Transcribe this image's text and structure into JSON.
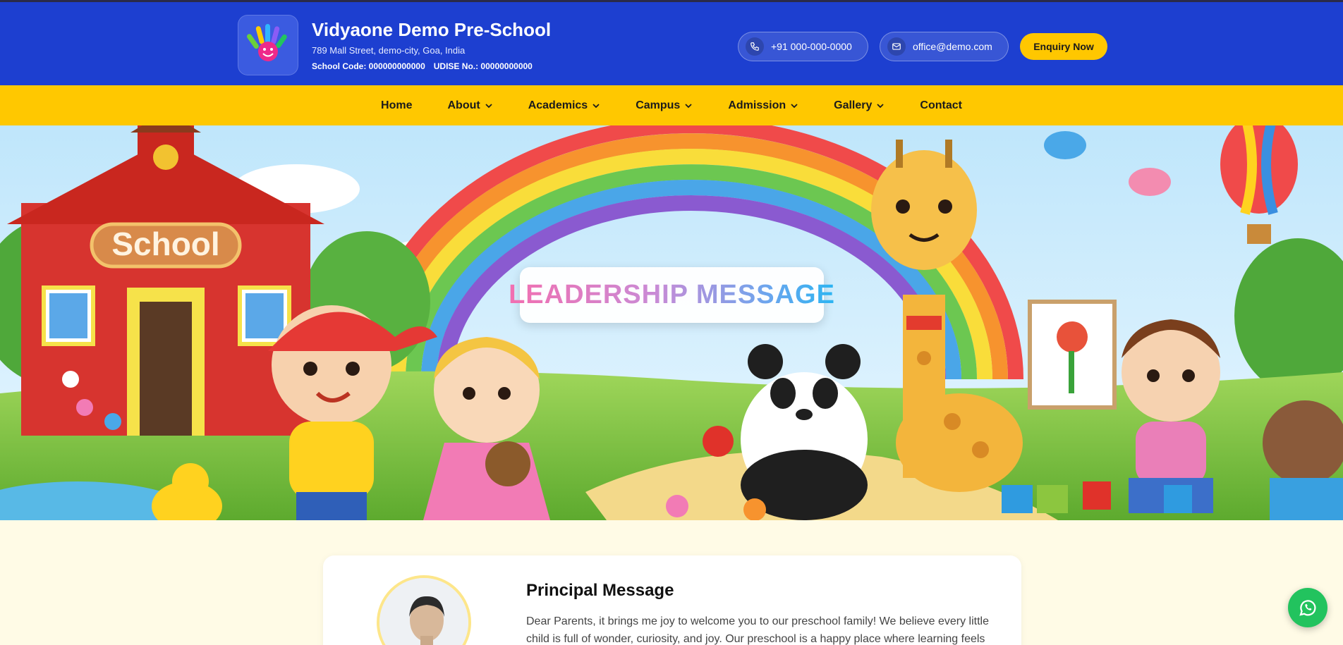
{
  "header": {
    "school_name": "Vidyaone Demo Pre-School",
    "address": "789 Mall Street, demo-city, Goa, India",
    "school_code": "School Code: 000000000000",
    "udise": "UDISE No.: 00000000000",
    "phone": "+91 000-000-0000",
    "email": "office@demo.com",
    "enquiry_label": "Enquiry Now"
  },
  "nav": {
    "items": [
      {
        "label": "Home",
        "dropdown": false
      },
      {
        "label": "About",
        "dropdown": true
      },
      {
        "label": "Academics",
        "dropdown": true
      },
      {
        "label": "Campus",
        "dropdown": true
      },
      {
        "label": "Admission",
        "dropdown": true
      },
      {
        "label": "Gallery",
        "dropdown": true
      },
      {
        "label": "Contact",
        "dropdown": false
      }
    ]
  },
  "hero": {
    "title": "LEADERSHIP MESSAGE",
    "school_sign": "School"
  },
  "principal": {
    "title": "Principal Message",
    "text": "Dear Parents, it brings me joy to welcome you to our preschool family! We believe every little child is full of wonder, curiosity, and joy. Our preschool is a happy place where learning feels"
  },
  "colors": {
    "header_bg": "#1d3fd0",
    "nav_bg": "#ffc800",
    "accent": "#ffc700",
    "whatsapp": "#22c35e"
  }
}
